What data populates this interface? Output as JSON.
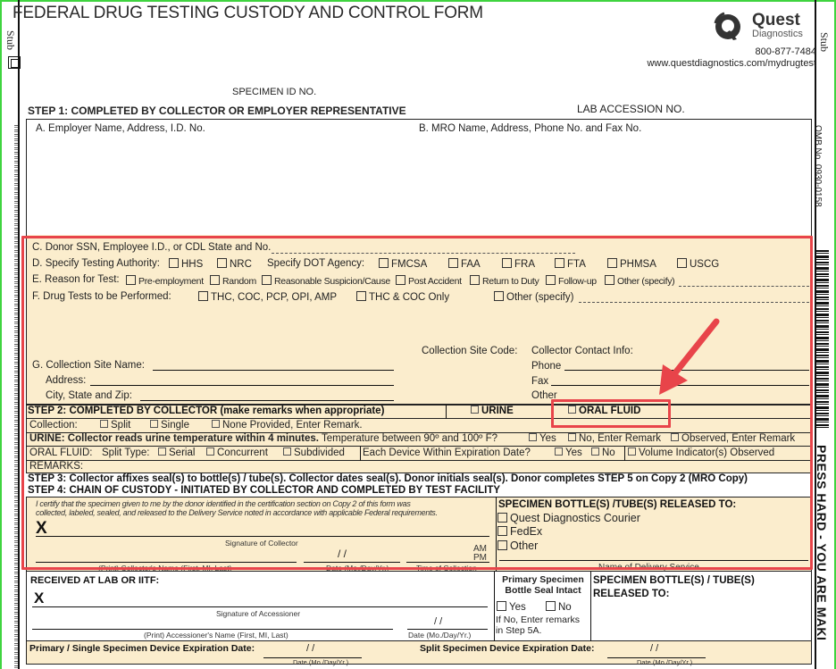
{
  "header": {
    "title": "FEDERAL DRUG TESTING CUSTODY AND CONTROL FORM",
    "stub_label": "Stub",
    "brand": {
      "name": "Quest",
      "sub": "Diagnostics",
      "phone": "800-877-7484",
      "url": "www.questdiagnostics.com/mydrugtest"
    },
    "specimen_id_label": "SPECIMEN ID NO.",
    "lab_accession_label": "LAB ACCESSION NO.",
    "omb": "OMB No. 0930-0158",
    "press_hard": "PRESS HARD - YOU ARE MAKI"
  },
  "step1": {
    "heading": "STEP 1: COMPLETED BY COLLECTOR OR EMPLOYER REPRESENTATIVE",
    "a_label": "A. Employer Name, Address, I.D. No.",
    "b_label": "B. MRO Name, Address, Phone No. and Fax No.",
    "c_label": "C. Donor SSN, Employee I.D., or CDL State and No.",
    "d_label": "D. Specify Testing Authority:",
    "d_options": [
      "HHS",
      "NRC"
    ],
    "dot_label": "Specify DOT Agency:",
    "dot_options": [
      "FMCSA",
      "FAA",
      "FRA",
      "FTA",
      "PHMSA",
      "USCG"
    ],
    "e_label": "E. Reason for Test:",
    "e_options": [
      "Pre-employment",
      "Random",
      "Reasonable Suspicion/Cause",
      "Post Accident",
      "Return to Duty",
      "Follow-up",
      "Other (specify)"
    ],
    "f_label": "F. Drug Tests to be Performed:",
    "f_options": [
      "THC, COC, PCP, OPI, AMP",
      "THC & COC Only",
      "Other (specify)"
    ],
    "g_label": "G. Collection Site Name:",
    "address_label": "Address:",
    "city_label": "City, State and Zip:",
    "site_code_label": "Collection Site Code:",
    "contact_label": "Collector Contact Info:",
    "phone_label": "Phone",
    "fax_label": "Fax",
    "other_label": "Other"
  },
  "step2": {
    "heading": "STEP 2: COMPLETED BY COLLECTOR (make remarks when appropriate)",
    "specimen_types": [
      "URINE",
      "ORAL FLUID"
    ],
    "collection_label": "Collection:",
    "collection_options": [
      "Split",
      "Single",
      "None Provided, Enter Remark."
    ],
    "urine_bold": "URINE: Collector reads urine temperature within 4 minutes.",
    "urine_q": "Temperature between 90º and 100º F?",
    "urine_options": [
      "Yes",
      "No, Enter Remark",
      "Observed, Enter Remark"
    ],
    "oral_label": "ORAL FLUID:",
    "split_type_label": "Split Type:",
    "split_options": [
      "Serial",
      "Concurrent",
      "Subdivided"
    ],
    "expiration_q": "Each Device Within Expiration Date?",
    "expiration_options": [
      "Yes",
      "No"
    ],
    "volume_option": "Volume Indicator(s) Observed",
    "remarks_label": "REMARKS:"
  },
  "step3": {
    "text": "STEP 3: Collector affixes seal(s) to bottle(s) / tube(s). Collector dates seal(s). Donor initials seal(s). Donor completes STEP 5 on Copy 2 (MRO Copy)"
  },
  "step4": {
    "heading": "STEP 4: CHAIN OF CUSTODY - INITIATED BY COLLECTOR AND COMPLETED BY TEST FACILITY",
    "certify_1": "I certify that the specimen given to me by the donor identified in the certification section on Copy 2 of this form was",
    "certify_2": "collected, labeled, sealed, and released to the Delivery Service noted in accordance with applicable Federal requirements.",
    "x_mark": "X",
    "sig_collector": "Signature of Collector",
    "am": "AM",
    "pm": "PM",
    "date_slashes": "/      /",
    "print_collector": "(Print) Collector's Name (First, MI, Last)",
    "date_label": "Date (Mo./Day/Yr.)",
    "time_label": "Time of Collection",
    "released_heading": "SPECIMEN BOTTLE(S) /TUBE(S) RELEASED TO:",
    "released_options": [
      "Quest Diagnostics Courier",
      "FedEx",
      "Other"
    ],
    "delivery_label": "Name of Delivery Service",
    "received_heading": "RECEIVED AT LAB OR IITF:",
    "sig_accessioner": "Signature of Accessioner",
    "print_accessioner": "(Print) Accessioner's Name (First, MI, Last)",
    "seal_heading_1": "Primary Specimen",
    "seal_heading_2": "Bottle Seal Intact",
    "seal_options": [
      "Yes",
      "No"
    ],
    "seal_note_1": "If No, Enter remarks",
    "seal_note_2": "in Step 5A.",
    "released2_1": "SPECIMEN BOTTLE(S) / TUBE(S)",
    "released2_2": "RELEASED TO:",
    "primary_exp": "Primary / Single Specimen Device Expiration Date:",
    "split_exp": "Split Specimen Device Expiration Date:"
  },
  "annotation": {
    "color": "#e8444a",
    "highlight_target": "ORAL FLUID"
  }
}
